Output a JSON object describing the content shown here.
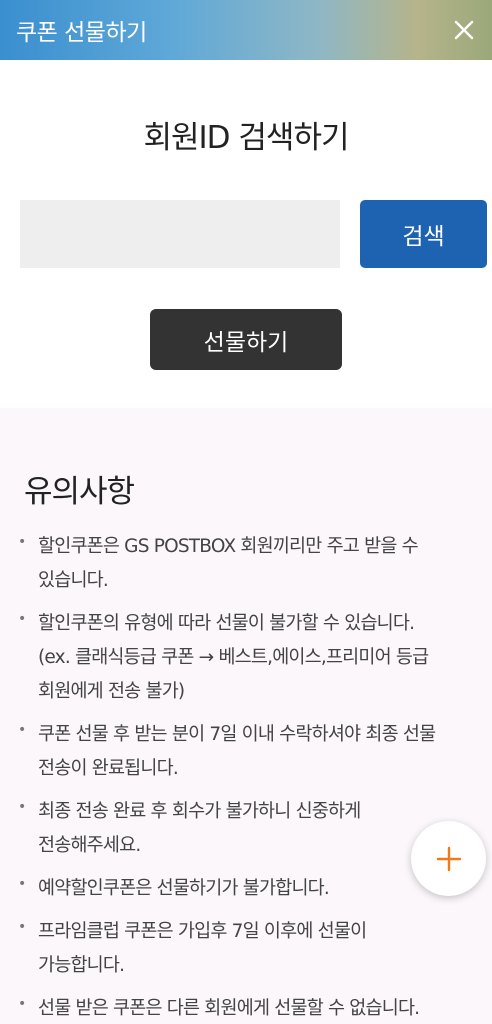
{
  "header": {
    "title": "쿠폰 선물하기",
    "close_icon": "close-icon"
  },
  "search": {
    "title": "회원ID 검색하기",
    "input_value": "",
    "input_placeholder": "",
    "button_label": "검색"
  },
  "gift": {
    "button_label": "선물하기"
  },
  "notice": {
    "title": "유의사항",
    "items": [
      {
        "lines": [
          "할인쿠폰은 GS POSTBOX 회원끼리만 주고 받을 수",
          "있습니다."
        ]
      },
      {
        "lines": [
          "할인쿠폰의 유형에 따라 선물이 불가할 수 있습니다.",
          "(ex. 클래식등급 쿠폰 → 베스트,에이스,프리미어 등급",
          "회원에게 전송 불가)"
        ]
      },
      {
        "lines": [
          "쿠폰 선물 후 받는 분이 7일 이내 수락하셔야 최종 선물",
          "전송이 완료됩니다."
        ]
      },
      {
        "lines": [
          "최종 전송 완료 후 회수가 불가하니 신중하게",
          "전송해주세요."
        ]
      },
      {
        "lines": [
          "예약할인쿠폰은 선물하기가 불가합니다."
        ]
      },
      {
        "lines": [
          "프라임클럽 쿠폰은 가입후 7일 이후에 선물이",
          "가능합니다."
        ]
      },
      {
        "lines": [
          "선물 받은 쿠폰은 다른 회원에게 선물할 수 없습니다."
        ]
      }
    ]
  },
  "fab": {
    "icon": "plus-icon",
    "color": "#f07a1a"
  },
  "colors": {
    "search_button": "#1e63b1",
    "gift_button": "#333333",
    "notice_background": "#fbf7fb"
  }
}
